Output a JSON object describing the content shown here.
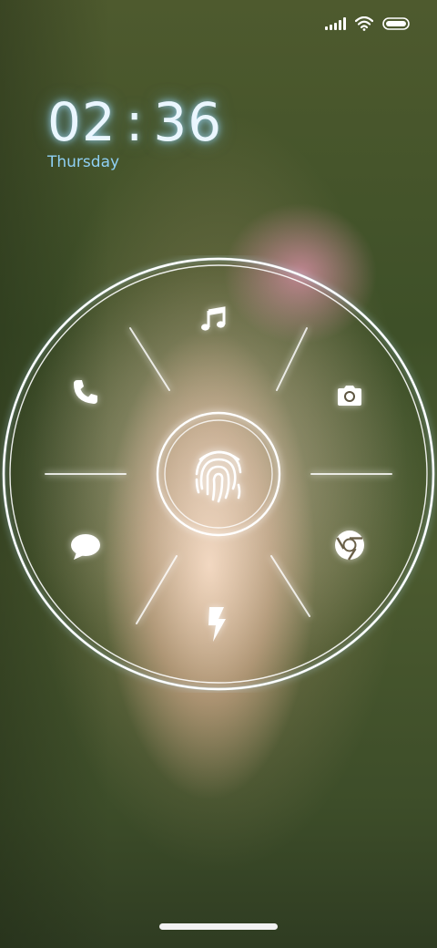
{
  "status_bar": {
    "icons": [
      "signal-icon",
      "wifi-icon",
      "battery-icon"
    ]
  },
  "lock_screen": {
    "hours": "02",
    "separator": ":",
    "minutes": "36",
    "day": "Thursday"
  },
  "quick_launch": {
    "apps": [
      "music-icon",
      "camera-icon",
      "chrome-icon",
      "flashlight-icon",
      "messages-icon",
      "phone-icon"
    ],
    "center": "fingerprint-icon"
  },
  "colors": {
    "clock": "#eaf6ff",
    "day": "#8fd0f4",
    "ring": "#ffffff"
  }
}
